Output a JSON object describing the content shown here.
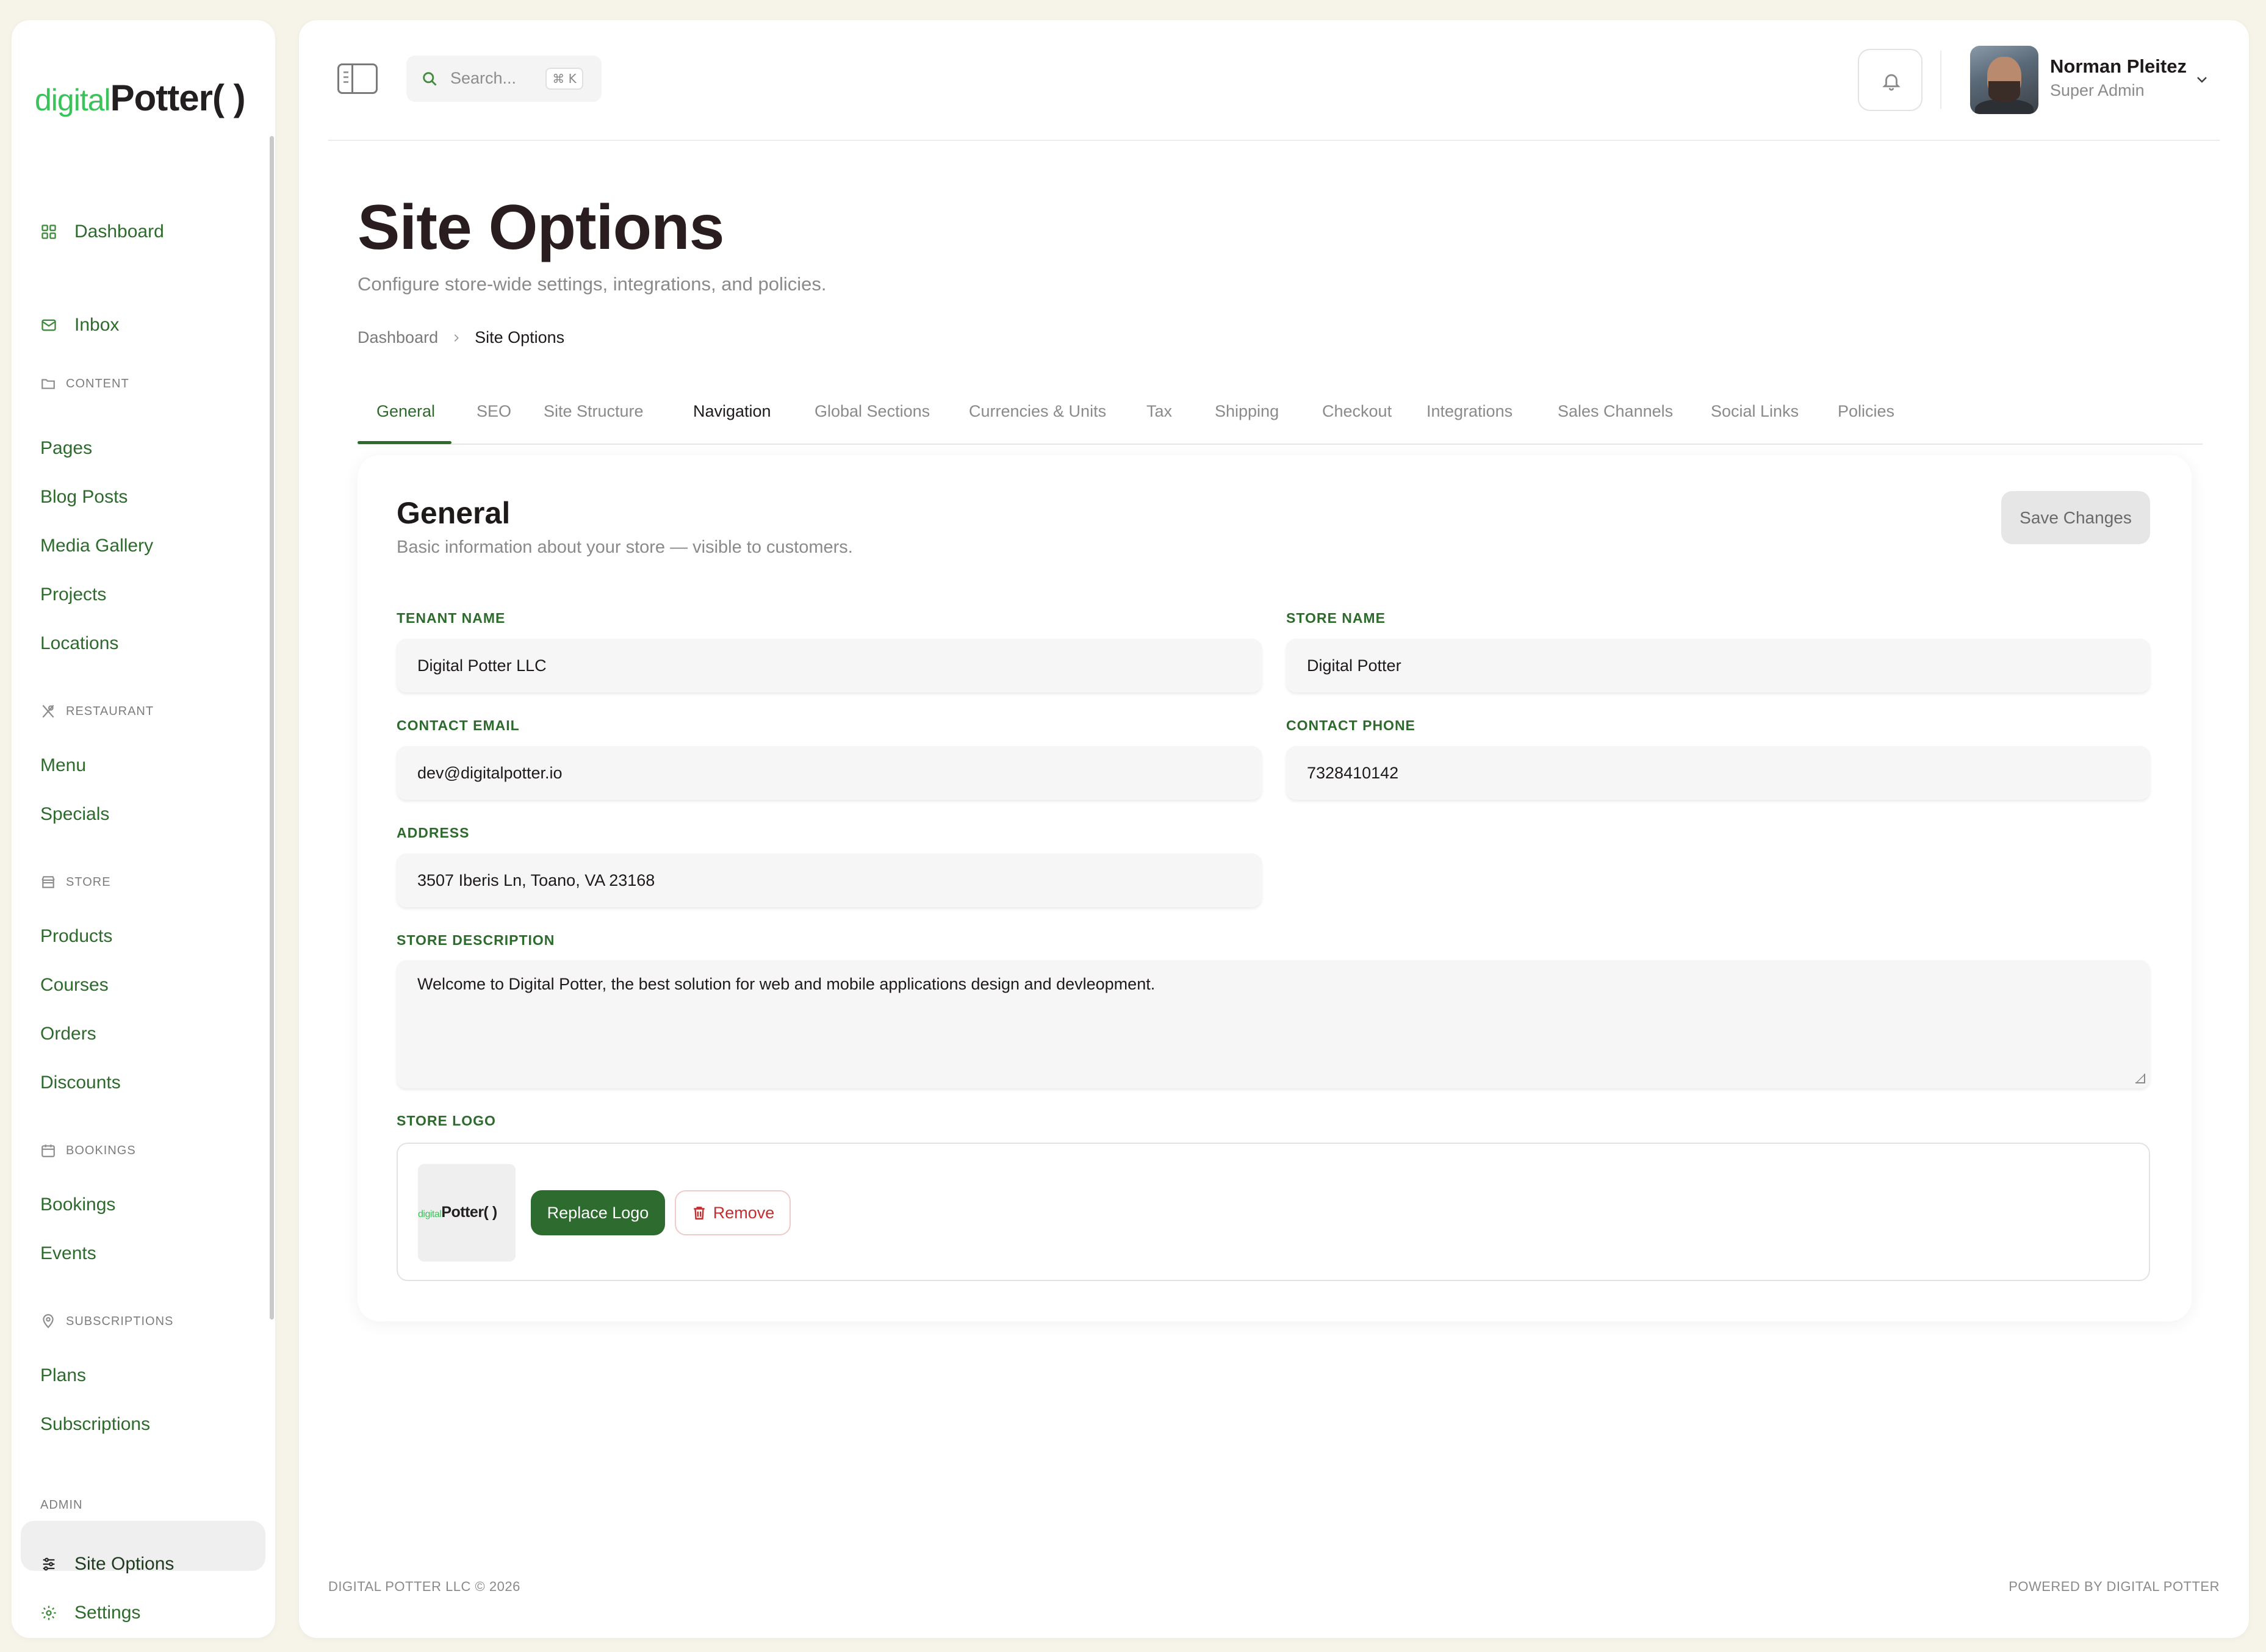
{
  "brand": {
    "logo_part1": "digital",
    "logo_part2": "Potter",
    "logo_part3": "( )",
    "accent_green": "#2d6b2c",
    "logo_green": "#3cc25a"
  },
  "sidebar": {
    "top_items": [
      {
        "label": "Dashboard",
        "icon": "grid-icon"
      },
      {
        "label": "Inbox",
        "icon": "mail-icon"
      }
    ],
    "sections": {
      "content": {
        "label": "Content",
        "icon": "folder-icon",
        "items": [
          "Pages",
          "Blog Posts",
          "Media Gallery",
          "Projects",
          "Locations"
        ]
      },
      "restaurant": {
        "label": "Restaurant",
        "icon": "utensils-icon",
        "items": [
          "Menu",
          "Specials"
        ]
      },
      "store": {
        "label": "Store",
        "icon": "store-icon",
        "items": [
          "Products",
          "Courses",
          "Orders",
          "Discounts"
        ]
      },
      "bookings": {
        "label": "Bookings",
        "icon": "calendar-icon",
        "items": [
          "Bookings",
          "Events"
        ]
      },
      "subscriptions": {
        "label": "Subscriptions",
        "icon": "map-pin-icon",
        "items": [
          "Plans",
          "Subscriptions"
        ]
      },
      "admin": {
        "label": "Admin",
        "items": [
          {
            "label": "Site Options",
            "icon": "sliders-icon",
            "active": true
          },
          {
            "label": "Settings",
            "icon": "gear-icon"
          }
        ]
      }
    }
  },
  "header": {
    "search_placeholder": "Search...",
    "search_shortcut": "⌘ K",
    "user_name": "Norman Pleitez",
    "user_role": "Super Admin"
  },
  "page": {
    "title": "Site Options",
    "subtitle": "Configure store-wide settings, integrations, and policies.",
    "breadcrumb": [
      "Dashboard",
      "Site Options"
    ]
  },
  "tabs": [
    "General",
    "SEO",
    "Site Structure",
    "Navigation",
    "Global Sections",
    "Currencies & Units",
    "Tax",
    "Shipping",
    "Checkout",
    "Integrations",
    "Sales Channels",
    "Social Links",
    "Policies"
  ],
  "active_tab": "General",
  "form": {
    "title": "General",
    "subtitle": "Basic information about your store — visible to customers.",
    "save_label": "Save Changes",
    "fields": {
      "tenant_name": {
        "label": "Tenant Name",
        "value": "Digital Potter LLC"
      },
      "store_name": {
        "label": "Store Name",
        "value": "Digital Potter"
      },
      "contact_email": {
        "label": "Contact Email",
        "value": "dev@digitalpotter.io"
      },
      "contact_phone": {
        "label": "Contact Phone",
        "value": "7328410142"
      },
      "address": {
        "label": "Address",
        "value": "3507 Iberis Ln, Toano, VA 23168"
      },
      "store_description": {
        "label": "Store Description",
        "value": "Welcome to Digital Potter, the best solution for web and mobile applications design and devleopment."
      }
    },
    "store_logo": {
      "label": "Store Logo",
      "replace_label": "Replace Logo",
      "remove_label": "Remove"
    }
  },
  "footer": {
    "left": "DIGITAL POTTER LLC © 2026",
    "right": "POWERED BY DIGITAL POTTER"
  }
}
